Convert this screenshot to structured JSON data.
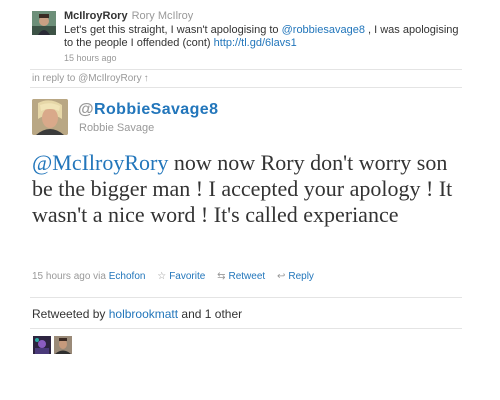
{
  "parent_tweet": {
    "screen_name": "McIlroyRory",
    "full_name": "Rory McIlroy",
    "text_before": "Let's get this straight, I wasn't apologising to ",
    "mention": "@robbiesavage8",
    "text_after": " , I was apologising to the people I offended (cont) ",
    "link": "http://tl.gd/6lavs1",
    "timestamp": "15 hours ago"
  },
  "in_reply_to": {
    "label": "in reply to @McIlroyRory",
    "arrow": "↑"
  },
  "main_tweet": {
    "at": "@",
    "screen_name": "RobbieSavage8",
    "full_name": "Robbie Savage",
    "mention": "@McIlroyRory",
    "text": " now now Rory don't worry son be the bigger man ! I accepted your apology ! It wasn't a nice word ! It's called experiance",
    "timestamp": "15 hours ago",
    "via_label": "via",
    "source": "Echofon",
    "actions": {
      "favorite_icon": "star-icon",
      "favorite": "Favorite",
      "retweet_icon": "retweet-icon",
      "retweet": "Retweet",
      "reply_icon": "reply-arrow-icon",
      "reply": "Reply"
    }
  },
  "retweets": {
    "prefix": "Retweeted by ",
    "user": "holbrookmatt",
    "suffix": " and 1 other"
  },
  "colors": {
    "link": "#2276bb",
    "meta": "#999999",
    "text": "#333333",
    "separator": "#e4e4e4"
  }
}
